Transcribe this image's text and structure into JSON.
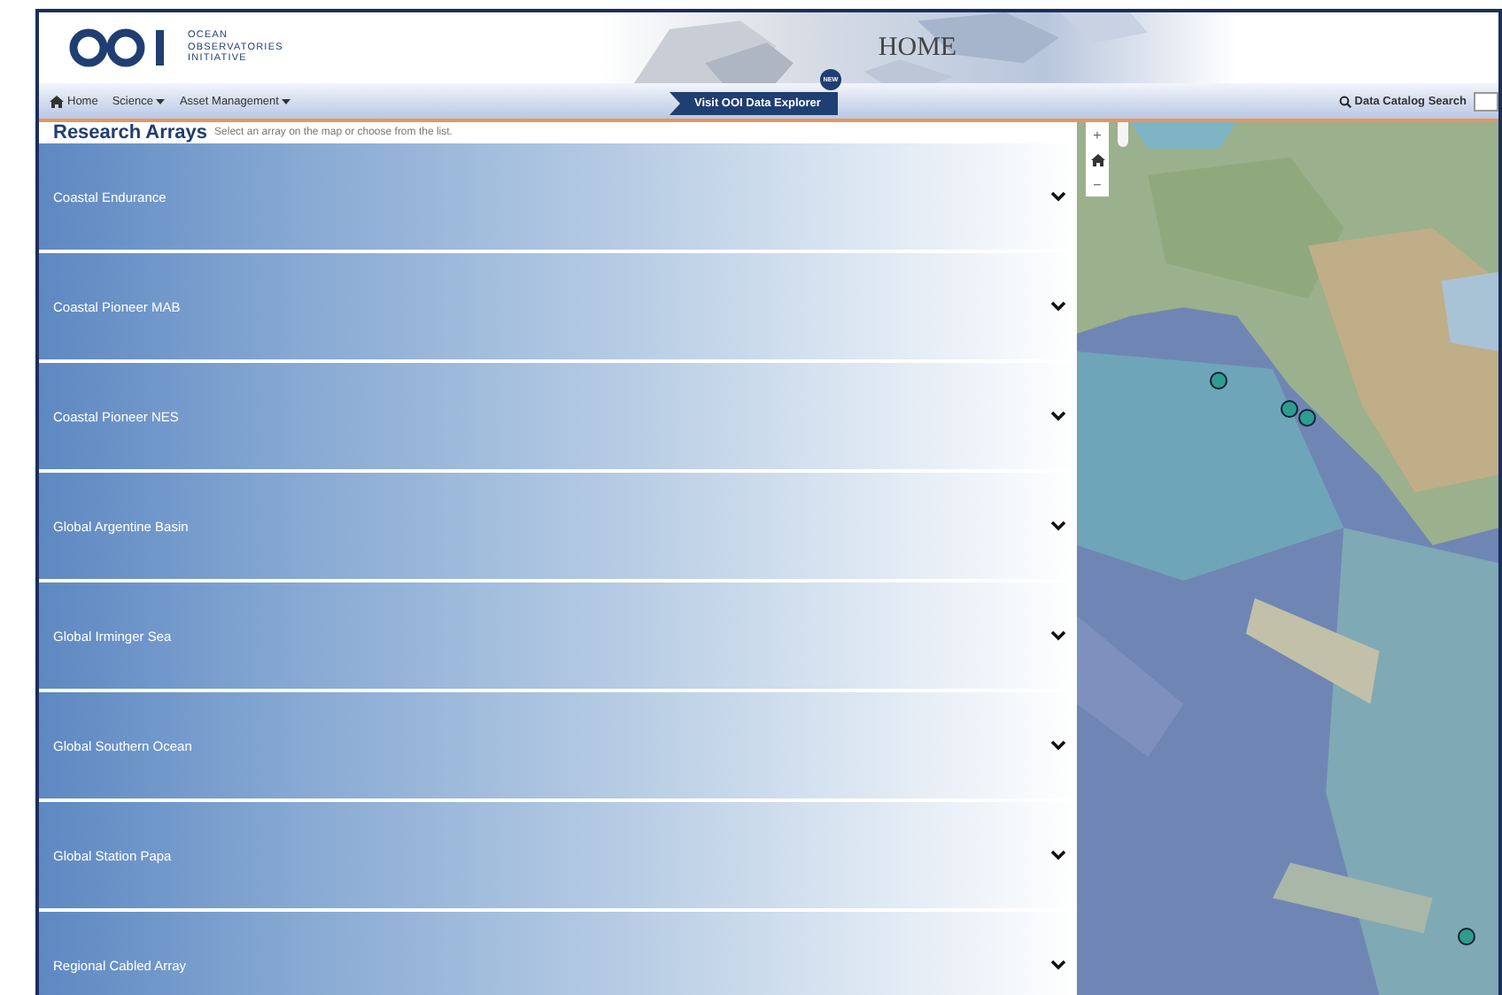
{
  "header": {
    "logo_text": [
      "OCEAN",
      "OBSERVATORIES",
      "INITIATIVE"
    ],
    "page_title": "HOME"
  },
  "nav": {
    "items": [
      {
        "label": "Home",
        "kind": "home"
      },
      {
        "label": "Science",
        "kind": "menu"
      },
      {
        "label": "Asset Management",
        "kind": "menu"
      }
    ],
    "explorer_button": "Visit OOI Data Explorer",
    "new_badge": "NEW",
    "search_label": "Data Catalog Search"
  },
  "arrays": {
    "title": "Research Arrays",
    "subtitle": "Select an array on the map or choose from the list.",
    "items": [
      {
        "label": "Coastal Endurance",
        "expanded": false
      },
      {
        "label": "Coastal Pioneer MAB",
        "expanded": false
      },
      {
        "label": "Coastal Pioneer NES",
        "expanded": false
      },
      {
        "label": "Global Argentine Basin",
        "expanded": false
      },
      {
        "label": "Global Irminger Sea",
        "expanded": false
      },
      {
        "label": "Global Southern Ocean",
        "expanded": false
      },
      {
        "label": "Global Station Papa",
        "expanded": false
      },
      {
        "label": "Regional Cabled Array",
        "expanded": false
      }
    ]
  },
  "map": {
    "zoom_in": "+",
    "zoom_out": "−"
  }
}
